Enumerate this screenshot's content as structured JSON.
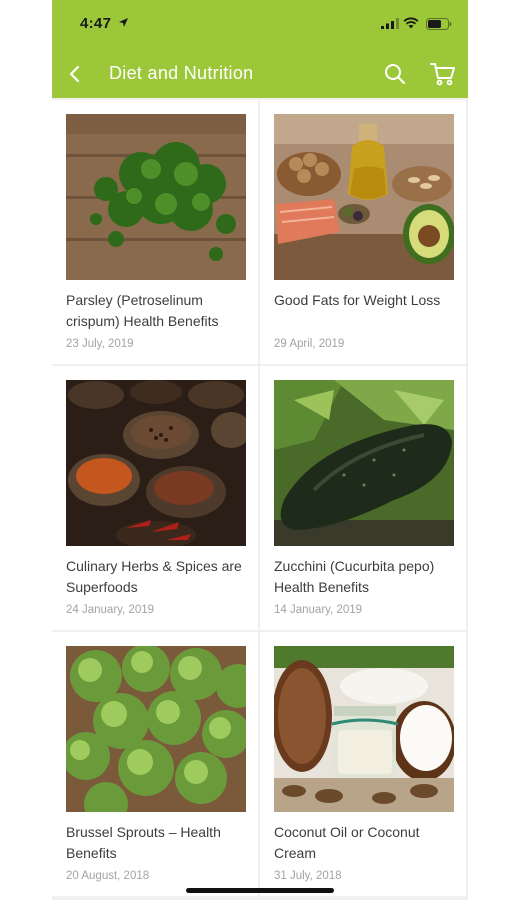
{
  "status_bar": {
    "time": "4:47"
  },
  "header": {
    "title": "Diet and Nutrition"
  },
  "articles": [
    {
      "title": "Parsley (Petroselinum crispum) Health Benefits",
      "date": "23 July, 2019",
      "image": "parsley"
    },
    {
      "title": "Good Fats for Weight Loss",
      "date": "29 April, 2019",
      "image": "good-fats"
    },
    {
      "title": "Culinary Herbs & Spices are Superfoods",
      "date": "24 January, 2019",
      "image": "herbs-spices"
    },
    {
      "title": "Zucchini (Cucurbita pepo) Health Benefits",
      "date": "14 January, 2019",
      "image": "zucchini"
    },
    {
      "title": "Brussel Sprouts – Health Benefits",
      "date": "20 August, 2018",
      "image": "brussel-sprouts"
    },
    {
      "title": "Coconut Oil or Coconut Cream",
      "date": "31 July, 2018",
      "image": "coconut"
    }
  ],
  "colors": {
    "header": "#9cc739",
    "background": "#f0f0f0",
    "card": "#ffffff",
    "title_text": "#3d3d3d",
    "date_text": "#a3a3a3"
  },
  "icons": [
    "location-arrow-icon",
    "signal-icon",
    "wifi-icon",
    "battery-icon",
    "back-icon",
    "search-icon",
    "cart-icon"
  ]
}
